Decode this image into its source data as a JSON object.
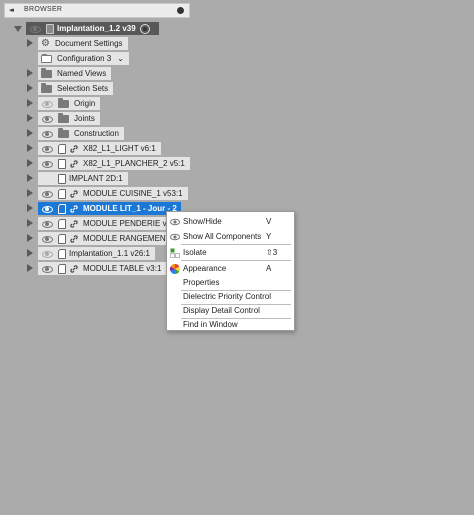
{
  "browser": {
    "title": "BROWSER",
    "collapse_glyph": "◂◂",
    "root": "Implantation_1.2 v39",
    "items": {
      "document_settings": "Document Settings",
      "configuration": "Configuration 3",
      "named_views": "Named Views",
      "selection_sets": "Selection Sets",
      "origin": "Origin",
      "joints": "Joints",
      "construction": "Construction",
      "x82_light": "X82_L1_LIGHT v6:1",
      "x82_plancher": "X82_L1_PLANCHER_2 v5:1",
      "implant_2d": "IMPLANT 2D:1",
      "module_cuisine": "MODULE CUISINE_1 v53:1",
      "module_lit": "MODULE LIT_1 - Jour - 2",
      "module_penderie": "MODULE PENDERIE v23",
      "module_rangement": "MODULE RANGEMENT_",
      "implantation_11": "Implantation_1.1 v26:1",
      "module_table": "MODULE TABLE v3:1"
    }
  },
  "context_menu": {
    "show_hide": {
      "label": "Show/Hide",
      "shortcut": "V"
    },
    "show_all": {
      "label": "Show All Components",
      "shortcut": "Y"
    },
    "isolate": {
      "label": "Isolate",
      "shortcut": "⇧3"
    },
    "appearance": {
      "label": "Appearance",
      "shortcut": "A"
    },
    "properties": {
      "label": "Properties"
    },
    "dielectric": {
      "label": "Dielectric Priority Control"
    },
    "display_detail": {
      "label": "Display Detail Control"
    },
    "find_in_window": {
      "label": "Find in Window"
    }
  },
  "colors": {
    "panel_bg": "#ababab",
    "selection": "#1c78d6",
    "root_bg": "#585858"
  }
}
